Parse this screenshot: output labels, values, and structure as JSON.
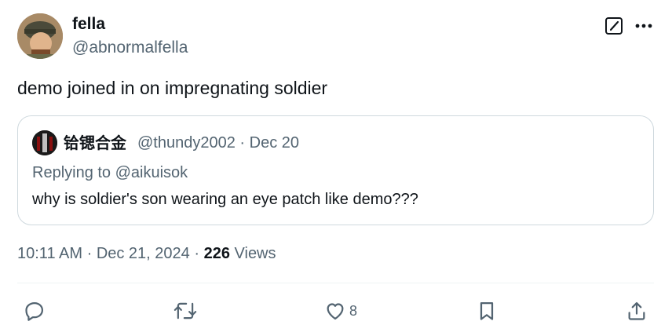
{
  "author": {
    "display_name": "fella",
    "handle": "@abnormalfella"
  },
  "tweet": {
    "text": "demo joined in on impregnating soldier",
    "time": "10:11 AM",
    "date": "Dec 21, 2024",
    "views_count": "226",
    "views_label": "Views"
  },
  "quote": {
    "display_name": "铪锶合金",
    "handle": "@thundy2002",
    "date": "Dec 20",
    "replying_prefix": "Replying to",
    "replying_to": "@aikuisok",
    "text": "why is soldier's son wearing an eye patch like demo???"
  },
  "actions": {
    "reply": {
      "icon": "reply-icon"
    },
    "retweet": {
      "icon": "retweet-icon"
    },
    "like": {
      "icon": "heart-icon",
      "count": "8"
    },
    "bookmark": {
      "icon": "bookmark-icon"
    },
    "share": {
      "icon": "share-icon"
    }
  },
  "colors": {
    "text": "#0f1419",
    "secondary": "#536471",
    "border": "#cfd9de"
  }
}
